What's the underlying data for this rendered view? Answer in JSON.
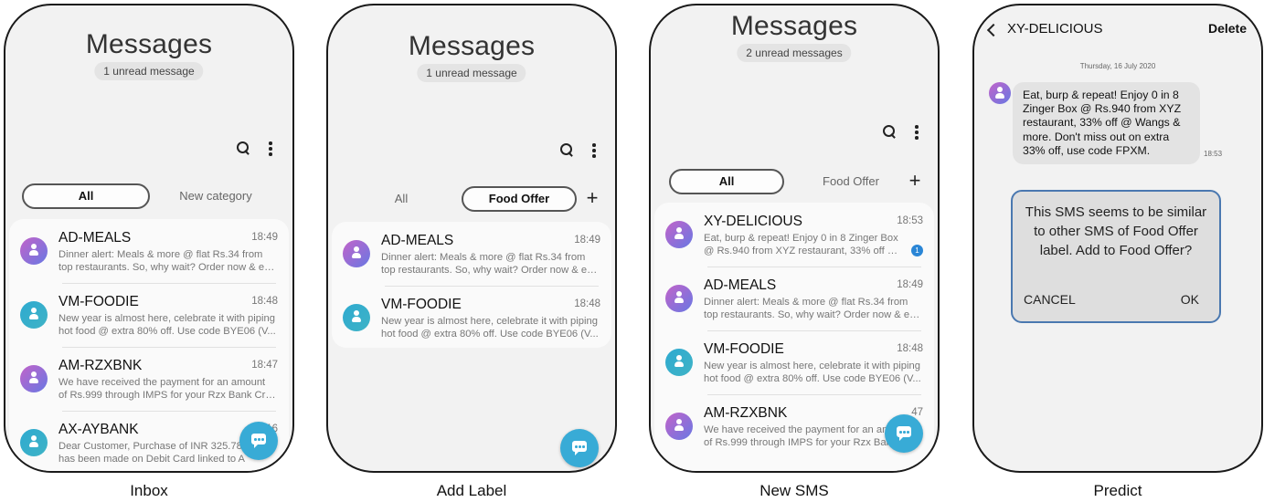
{
  "colors": {
    "fab": "#38abd6",
    "avatar_teal": "#2eaad0",
    "avatar_purple_start": "#c263c9",
    "avatar_purple_end": "#6878e3",
    "badge": "#2a86d6",
    "dialog_border": "#4a78b0"
  },
  "panels": {
    "inbox": {
      "caption": "Inbox",
      "title": "Messages",
      "unread": "1 unread message",
      "tabs": {
        "all": "All",
        "other": "New category"
      },
      "messages": [
        {
          "sender": "AD-MEALS",
          "time": "18:49",
          "line1": "Dinner alert: Meals & more @ flat Rs.34 from",
          "line2": "top restaurants. So, why wait? Order now & ex..."
        },
        {
          "sender": "VM-FOODIE",
          "time": "18:48",
          "line1": "New year is almost here, celebrate it with piping",
          "line2": "hot food @ extra 80% off. Use code BYE06 (V..."
        },
        {
          "sender": "AM-RZXBNK",
          "time": "18:47",
          "line1": "We have received the payment for an amount",
          "line2": "of Rs.999 through IMPS for your Rzx Bank Cre..."
        },
        {
          "sender": "AX-AYBANK",
          "time": "16",
          "line1": "Dear Customer, Purchase of INR 325.78",
          "line2": "has been made on Debit Card linked to A"
        }
      ]
    },
    "add_label": {
      "caption": "Add Label",
      "title": "Messages",
      "unread": "1 unread message",
      "tabs": {
        "all": "All",
        "food": "Food Offer",
        "plus": "+"
      },
      "messages": [
        {
          "sender": "AD-MEALS",
          "time": "18:49",
          "line1": "Dinner alert: Meals & more @ flat Rs.34 from",
          "line2": "top restaurants. So, why wait? Order now & ex..."
        },
        {
          "sender": "VM-FOODIE",
          "time": "18:48",
          "line1": "New year is almost here, celebrate it with piping",
          "line2": "hot food @ extra 80% off. Use code BYE06 (V..."
        }
      ]
    },
    "new_sms": {
      "caption": "New SMS",
      "title": "Messages",
      "unread": "2 unread messages",
      "tabs": {
        "all": "All",
        "food": "Food Offer",
        "plus": "+"
      },
      "messages": [
        {
          "sender": "XY-DELICIOUS",
          "time": "18:53",
          "line1": "Eat, burp & repeat! Enjoy 0 in 8 Zinger Box",
          "line2": "@ Rs.940 from XYZ restaurant, 33% off @ ...",
          "badge": "1"
        },
        {
          "sender": "AD-MEALS",
          "time": "18:49",
          "line1": "Dinner alert: Meals & more @ flat Rs.34 from",
          "line2": "top restaurants. So, why wait? Order now & ex..."
        },
        {
          "sender": "VM-FOODIE",
          "time": "18:48",
          "line1": "New year is almost here, celebrate it with piping",
          "line2": "hot food @ extra 80% off. Use code BYE06 (V..."
        },
        {
          "sender": "AM-RZXBNK",
          "time": "47",
          "line1": "We have received the payment for an am",
          "line2": "of Rs.999 through IMPS for your Rzx Bank"
        }
      ]
    },
    "predict": {
      "caption": "Predict",
      "contact": "XY-DELICIOUS",
      "delete": "Delete",
      "date": "Thursday, 16 July 2020",
      "message_lines": [
        "Eat, burp & repeat! Enjoy 0 in 8",
        "Zinger Box @ Rs.940 from XYZ",
        "restaurant, 33% off @ Wangs &",
        "more. Don't miss out on extra",
        "33% off, use code FPXM."
      ],
      "message_time": "18:53",
      "dialog": {
        "lines": [
          "This SMS seems to be similar",
          "to other SMS of Food Offer",
          "label. Add to Food Offer?"
        ],
        "cancel": "CANCEL",
        "ok": "OK"
      }
    }
  }
}
